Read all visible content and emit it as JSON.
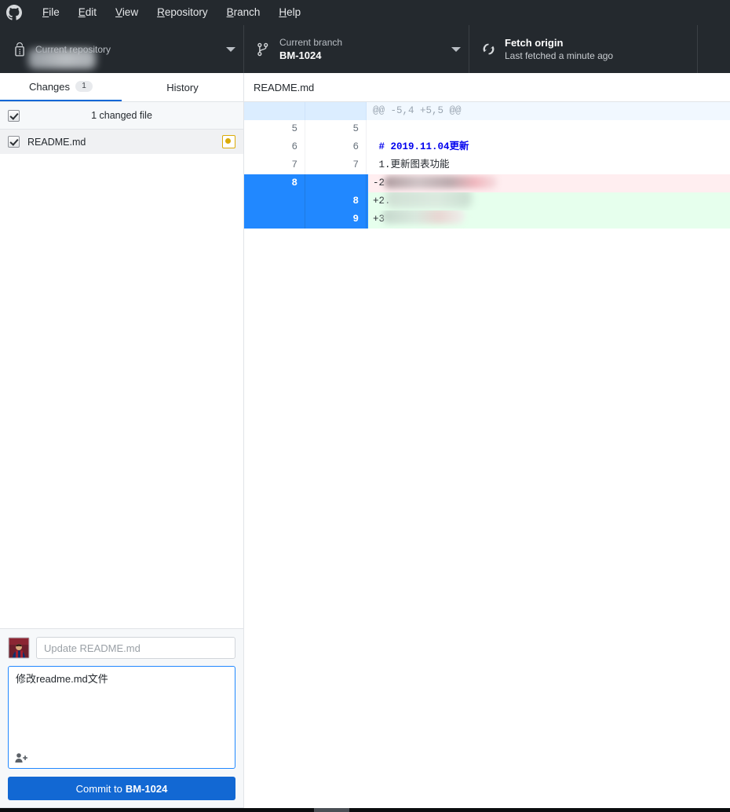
{
  "app": {
    "logo_icon": "github-mark-icon"
  },
  "menubar": {
    "items": [
      {
        "label": "File",
        "before": "",
        "acc": "F",
        "after": "ile"
      },
      {
        "label": "Edit",
        "before": "",
        "acc": "E",
        "after": "dit"
      },
      {
        "label": "View",
        "before": "",
        "acc": "V",
        "after": "iew"
      },
      {
        "label": "Repository",
        "before": "",
        "acc": "R",
        "after": "epository"
      },
      {
        "label": "Branch",
        "before": "",
        "acc": "B",
        "after": "ranch"
      },
      {
        "label": "Help",
        "before": "",
        "acc": "H",
        "after": "elp"
      }
    ]
  },
  "toolbar": {
    "repository": {
      "label": "Current repository",
      "value": "",
      "icon": "lock-icon",
      "caret": "chevron-down-icon"
    },
    "branch": {
      "label": "Current branch",
      "value": "BM-1024",
      "icon": "git-branch-icon",
      "caret": "chevron-down-icon"
    },
    "fetch": {
      "title": "Fetch origin",
      "subtitle": "Last fetched a minute ago",
      "icon": "sync-icon"
    }
  },
  "sidebar": {
    "tabs": [
      {
        "label": "Changes",
        "badge": "1",
        "active": true
      },
      {
        "label": "History",
        "badge": "",
        "active": false
      }
    ],
    "changes_header": "1 changed file",
    "files": [
      {
        "name": "README.md",
        "checked": true,
        "status_icon": "modified-dot-icon"
      }
    ],
    "commit": {
      "avatar_icon": "user-avatar-image",
      "summary_placeholder": "Update README.md",
      "summary_value": "",
      "description_value": "修改readme.md文件",
      "coauthor_icon": "add-co-author-icon",
      "button_prefix": "Commit to",
      "button_branch": "BM-1024"
    }
  },
  "diff": {
    "file_title": "README.md",
    "lines": [
      {
        "kind": "hunk",
        "old": "",
        "new": "",
        "text": "@@ -5,4 +5,5 @@",
        "selected": false,
        "blur": ""
      },
      {
        "kind": "ctx",
        "old": "5",
        "new": "5",
        "text": "",
        "selected": false,
        "blur": ""
      },
      {
        "kind": "ctx",
        "old": "6",
        "new": "6",
        "text": " # 2019.11.04更新",
        "selected": false,
        "blur": "",
        "style": "md-h1"
      },
      {
        "kind": "ctx",
        "old": "7",
        "new": "7",
        "text": " 1.更新图表功能",
        "selected": false,
        "blur": ""
      },
      {
        "kind": "del",
        "old": "8",
        "new": "",
        "text": "-2",
        "selected": true,
        "blur": "blur-del"
      },
      {
        "kind": "add",
        "old": "",
        "new": "8",
        "text": "+2.",
        "selected": true,
        "blur": "blur-add1"
      },
      {
        "kind": "add",
        "old": "",
        "new": "9",
        "text": "+3",
        "selected": true,
        "blur": "blur-add2"
      }
    ]
  },
  "colors": {
    "chrome_dark": "#24292e",
    "accent_blue": "#0366d6",
    "selection_blue": "#2188ff",
    "commit_button": "#1268d3",
    "diff_add_bg": "#e6ffed",
    "diff_del_bg": "#ffeef0",
    "hunk_bg": "#f1f8ff",
    "status_modified": "#dbab09"
  },
  "scrollbar": {
    "horizontal_thumb": true
  }
}
